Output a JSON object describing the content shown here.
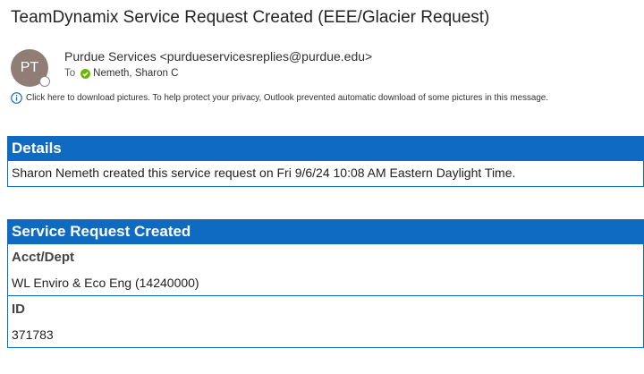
{
  "subject": "TeamDynamix Service Request Created (EEE/Glacier Request)",
  "sender": {
    "initials": "PT",
    "display": "Purdue Services <purdueservicesreplies@purdue.edu>",
    "to_label": "To",
    "recipient": "Nemeth, Sharon C",
    "avatar_color": "#8f7d76",
    "presence_color": "#6bb700"
  },
  "infobar": {
    "icon": "info-icon",
    "text": "Click here to download pictures. To help protect your privacy, Outlook prevented automatic download of some pictures in this message."
  },
  "details": {
    "header": "Details",
    "text": "Sharon Nemeth created this service request on Fri 9/6/24 10:08 AM Eastern Daylight Time."
  },
  "request": {
    "header": "Service Request Created",
    "fields": [
      {
        "label": "Acct/Dept",
        "value": "WL Enviro & Eco Eng (14240000)"
      },
      {
        "label": "ID",
        "value": "371783"
      }
    ]
  },
  "accent_color": "#0f6bc1"
}
